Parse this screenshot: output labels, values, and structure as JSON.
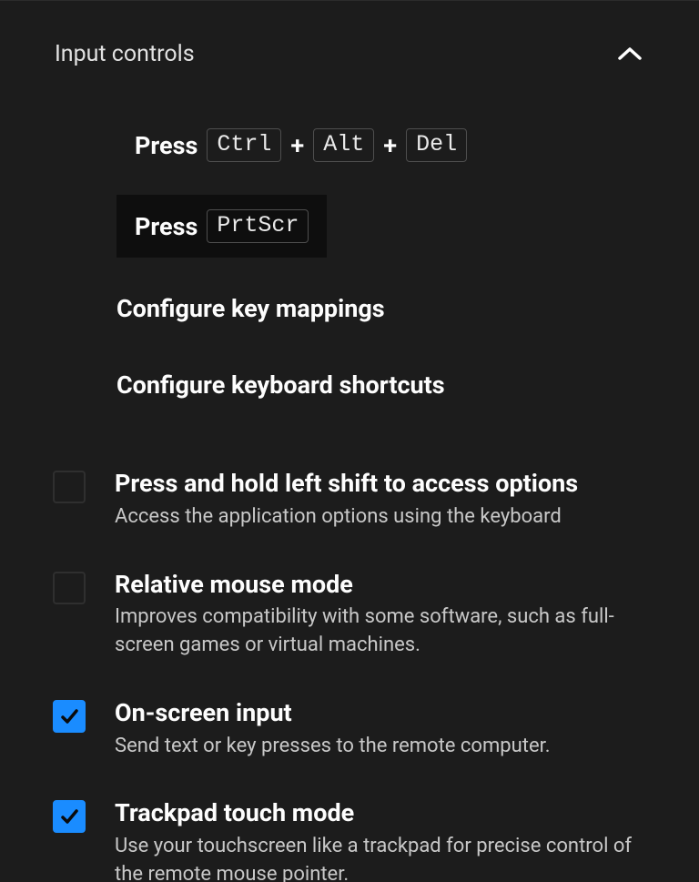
{
  "section": {
    "title": "Input controls"
  },
  "actions": {
    "ctrlaltdel": {
      "prefix": "Press",
      "keys": [
        "Ctrl",
        "Alt",
        "Del"
      ],
      "separator": "+"
    },
    "prtscr": {
      "prefix": "Press",
      "keys": [
        "PrtScr"
      ]
    },
    "keymap": "Configure key mappings",
    "shortcuts": "Configure keyboard shortcuts"
  },
  "options": [
    {
      "title": "Press and hold left shift to access options",
      "desc": "Access the application options using the keyboard",
      "checked": false
    },
    {
      "title": "Relative mouse mode",
      "desc": "Improves compatibility with some software, such as full-screen games or virtual machines.",
      "checked": false
    },
    {
      "title": "On-screen input",
      "desc": "Send text or key presses to the remote computer.",
      "checked": true
    },
    {
      "title": "Trackpad touch mode",
      "desc": "Use your touchscreen like a trackpad for precise control of the remote mouse pointer.",
      "checked": true
    }
  ]
}
